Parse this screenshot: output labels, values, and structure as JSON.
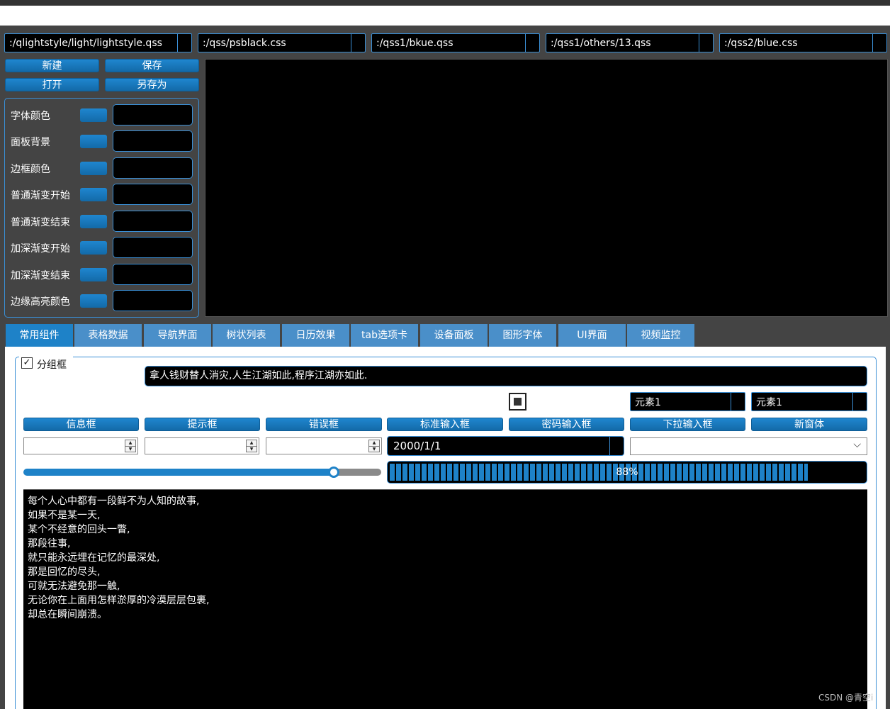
{
  "file_combos": [
    ":/qlightstyle/light/lightstyle.qss",
    ":/qss/psblack.css",
    ":/qss1/bkue.qss",
    ":/qss1/others/13.qss",
    ":/qss2/blue.css"
  ],
  "file_buttons": {
    "new": "新建",
    "save": "保存",
    "open": "打开",
    "save_as": "另存为"
  },
  "color_settings": [
    "字体颜色",
    "面板背景",
    "边框颜色",
    "普通渐变开始",
    "普通渐变结束",
    "加深渐变开始",
    "加深渐变结束",
    "边缘高亮颜色"
  ],
  "tabs": [
    "常用组件",
    "表格数据",
    "导航界面",
    "树状列表",
    "日历效果",
    "tab选项卡",
    "设备面板",
    "图形字体",
    "UI界面",
    "视频监控"
  ],
  "groupbox": {
    "label": "分组框",
    "checked": true,
    "line_edit_text": "拿人钱财替人消灾,人生江湖如此,程序江湖亦如此."
  },
  "element_combos": [
    "元素1",
    "元素1"
  ],
  "action_buttons": [
    "信息框",
    "提示框",
    "错误框",
    "标准输入框",
    "密码输入框",
    "下拉输入框",
    "新窗体"
  ],
  "date_combo": "2000/1/1",
  "slider": {
    "value_fraction": 0.88
  },
  "progress": {
    "value": 88,
    "label": "88%"
  },
  "text_lines": [
    "每个人心中都有一段鲜不为人知的故事,",
    "如果不是某一天,",
    "某个不经意的回头一瞥,",
    "那段往事,",
    "就只能永远埋在记忆的最深处,",
    "那是回忆的尽头,",
    "可就无法避免那一触,",
    "无论你在上面用怎样淤厚的冷漠层层包裹,",
    "却总在瞬间崩溃。"
  ],
  "watermark": "CSDN @青空i",
  "colors": {
    "accent": "#1e82c8",
    "panel": "#444444",
    "field": "#000000",
    "border": "#3a8fd6"
  },
  "icons": {
    "checkbox": "check-icon",
    "dropdown": "chevron-down-icon",
    "spin": "spin-arrows-icon"
  }
}
